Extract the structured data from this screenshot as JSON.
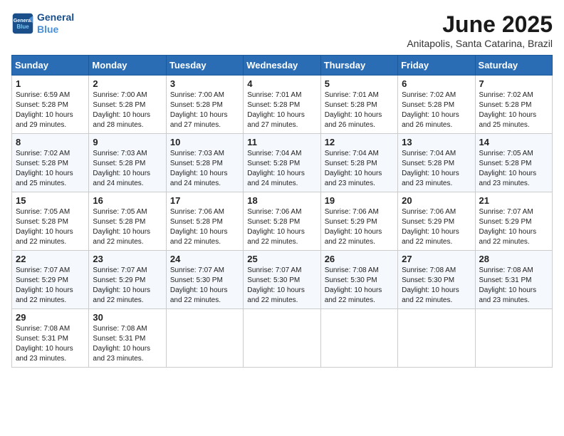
{
  "header": {
    "logo_line1": "General",
    "logo_line2": "Blue",
    "month": "June 2025",
    "location": "Anitapolis, Santa Catarina, Brazil"
  },
  "weekdays": [
    "Sunday",
    "Monday",
    "Tuesday",
    "Wednesday",
    "Thursday",
    "Friday",
    "Saturday"
  ],
  "weeks": [
    [
      {
        "day": "1",
        "sunrise": "6:59 AM",
        "sunset": "5:28 PM",
        "daylight": "10 hours and 29 minutes."
      },
      {
        "day": "2",
        "sunrise": "7:00 AM",
        "sunset": "5:28 PM",
        "daylight": "10 hours and 28 minutes."
      },
      {
        "day": "3",
        "sunrise": "7:00 AM",
        "sunset": "5:28 PM",
        "daylight": "10 hours and 27 minutes."
      },
      {
        "day": "4",
        "sunrise": "7:01 AM",
        "sunset": "5:28 PM",
        "daylight": "10 hours and 27 minutes."
      },
      {
        "day": "5",
        "sunrise": "7:01 AM",
        "sunset": "5:28 PM",
        "daylight": "10 hours and 26 minutes."
      },
      {
        "day": "6",
        "sunrise": "7:02 AM",
        "sunset": "5:28 PM",
        "daylight": "10 hours and 26 minutes."
      },
      {
        "day": "7",
        "sunrise": "7:02 AM",
        "sunset": "5:28 PM",
        "daylight": "10 hours and 25 minutes."
      }
    ],
    [
      {
        "day": "8",
        "sunrise": "7:02 AM",
        "sunset": "5:28 PM",
        "daylight": "10 hours and 25 minutes."
      },
      {
        "day": "9",
        "sunrise": "7:03 AM",
        "sunset": "5:28 PM",
        "daylight": "10 hours and 24 minutes."
      },
      {
        "day": "10",
        "sunrise": "7:03 AM",
        "sunset": "5:28 PM",
        "daylight": "10 hours and 24 minutes."
      },
      {
        "day": "11",
        "sunrise": "7:04 AM",
        "sunset": "5:28 PM",
        "daylight": "10 hours and 24 minutes."
      },
      {
        "day": "12",
        "sunrise": "7:04 AM",
        "sunset": "5:28 PM",
        "daylight": "10 hours and 23 minutes."
      },
      {
        "day": "13",
        "sunrise": "7:04 AM",
        "sunset": "5:28 PM",
        "daylight": "10 hours and 23 minutes."
      },
      {
        "day": "14",
        "sunrise": "7:05 AM",
        "sunset": "5:28 PM",
        "daylight": "10 hours and 23 minutes."
      }
    ],
    [
      {
        "day": "15",
        "sunrise": "7:05 AM",
        "sunset": "5:28 PM",
        "daylight": "10 hours and 22 minutes."
      },
      {
        "day": "16",
        "sunrise": "7:05 AM",
        "sunset": "5:28 PM",
        "daylight": "10 hours and 22 minutes."
      },
      {
        "day": "17",
        "sunrise": "7:06 AM",
        "sunset": "5:28 PM",
        "daylight": "10 hours and 22 minutes."
      },
      {
        "day": "18",
        "sunrise": "7:06 AM",
        "sunset": "5:28 PM",
        "daylight": "10 hours and 22 minutes."
      },
      {
        "day": "19",
        "sunrise": "7:06 AM",
        "sunset": "5:29 PM",
        "daylight": "10 hours and 22 minutes."
      },
      {
        "day": "20",
        "sunrise": "7:06 AM",
        "sunset": "5:29 PM",
        "daylight": "10 hours and 22 minutes."
      },
      {
        "day": "21",
        "sunrise": "7:07 AM",
        "sunset": "5:29 PM",
        "daylight": "10 hours and 22 minutes."
      }
    ],
    [
      {
        "day": "22",
        "sunrise": "7:07 AM",
        "sunset": "5:29 PM",
        "daylight": "10 hours and 22 minutes."
      },
      {
        "day": "23",
        "sunrise": "7:07 AM",
        "sunset": "5:29 PM",
        "daylight": "10 hours and 22 minutes."
      },
      {
        "day": "24",
        "sunrise": "7:07 AM",
        "sunset": "5:30 PM",
        "daylight": "10 hours and 22 minutes."
      },
      {
        "day": "25",
        "sunrise": "7:07 AM",
        "sunset": "5:30 PM",
        "daylight": "10 hours and 22 minutes."
      },
      {
        "day": "26",
        "sunrise": "7:08 AM",
        "sunset": "5:30 PM",
        "daylight": "10 hours and 22 minutes."
      },
      {
        "day": "27",
        "sunrise": "7:08 AM",
        "sunset": "5:30 PM",
        "daylight": "10 hours and 22 minutes."
      },
      {
        "day": "28",
        "sunrise": "7:08 AM",
        "sunset": "5:31 PM",
        "daylight": "10 hours and 23 minutes."
      }
    ],
    [
      {
        "day": "29",
        "sunrise": "7:08 AM",
        "sunset": "5:31 PM",
        "daylight": "10 hours and 23 minutes."
      },
      {
        "day": "30",
        "sunrise": "7:08 AM",
        "sunset": "5:31 PM",
        "daylight": "10 hours and 23 minutes."
      },
      null,
      null,
      null,
      null,
      null
    ]
  ],
  "labels": {
    "sunrise": "Sunrise:",
    "sunset": "Sunset:",
    "daylight": "Daylight:"
  }
}
